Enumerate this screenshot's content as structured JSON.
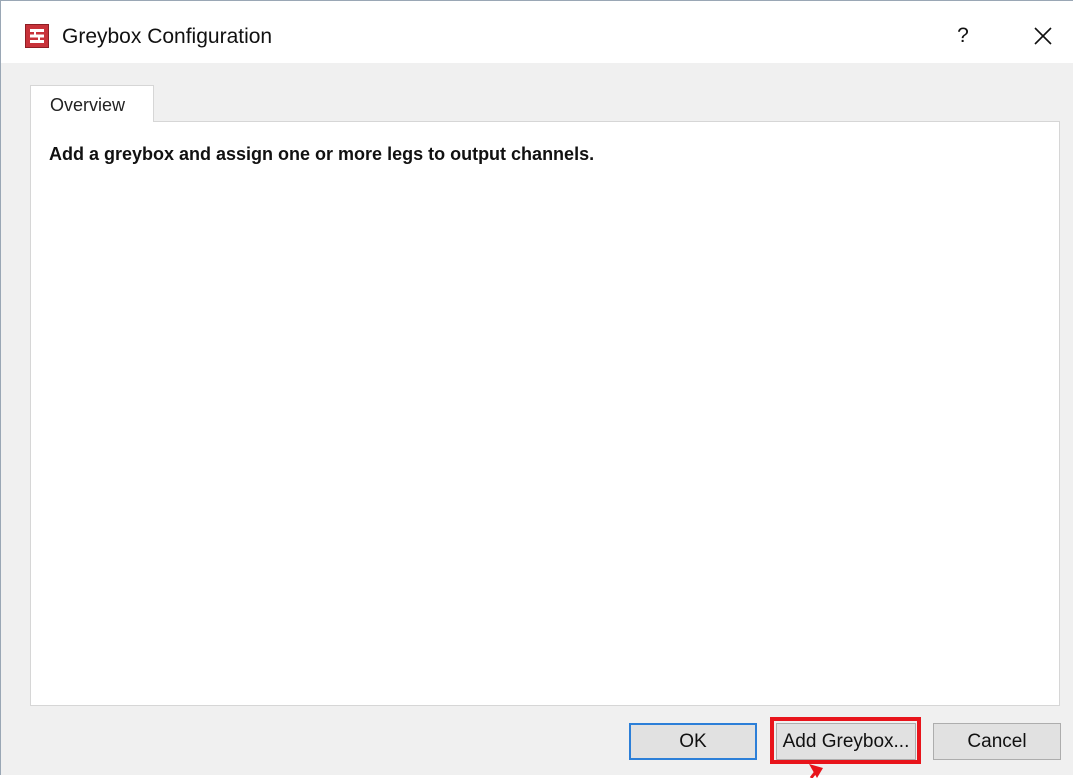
{
  "window": {
    "title": "Greybox Configuration",
    "help_label": "?",
    "icon": "greybox-app-icon"
  },
  "tabs": [
    {
      "label": "Overview",
      "selected": true
    }
  ],
  "overview": {
    "instructions": "Add a greybox and assign one or more legs to output channels."
  },
  "buttons": {
    "ok_label": "OK",
    "add_greybox_label": "Add Greybox...",
    "cancel_label": "Cancel"
  },
  "annotation": {
    "highlight_color": "#e8141b",
    "target": "Add Greybox... button"
  },
  "colors": {
    "dialog_bg": "#f0f0f0",
    "app_icon_red": "#c8323a",
    "default_button_border": "#2c7fd8"
  }
}
